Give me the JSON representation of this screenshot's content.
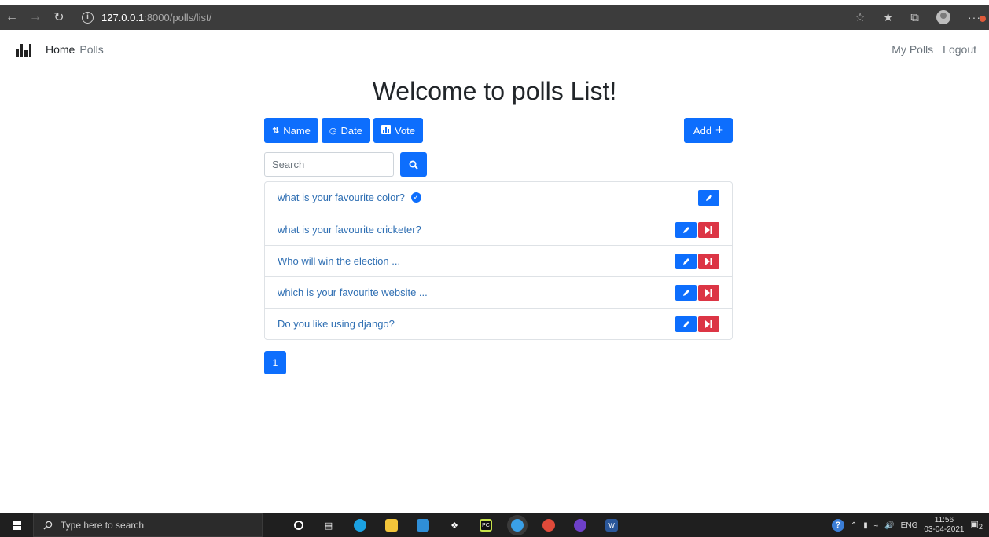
{
  "browser": {
    "url_host": "127.0.0.1",
    "url_path": ":8000/polls/list/"
  },
  "navbar": {
    "links": [
      "Home",
      "Polls"
    ],
    "right_links": [
      "My Polls",
      "Logout"
    ]
  },
  "page": {
    "title": "Welcome to polls List!",
    "sort_buttons": [
      "Name",
      "Date",
      "Vote"
    ],
    "add_label": "Add",
    "search_placeholder": "Search",
    "polls": [
      {
        "text": "what is your favourite color?",
        "verified": true
      },
      {
        "text": "what is your favourite cricketer?",
        "verified": false
      },
      {
        "text": "Who will win the election ...",
        "verified": false
      },
      {
        "text": "which is your favourite website ...",
        "verified": false
      },
      {
        "text": "Do you like using django?",
        "verified": false
      }
    ],
    "current_page": "1"
  },
  "taskbar": {
    "search_placeholder": "Type here to search",
    "language": "ENG",
    "time": "11:56",
    "date": "03-04-2021",
    "notification_count": "2"
  },
  "colors": {
    "primary": "#0d6efd",
    "danger": "#dc3545",
    "link": "#2f6fb3"
  }
}
